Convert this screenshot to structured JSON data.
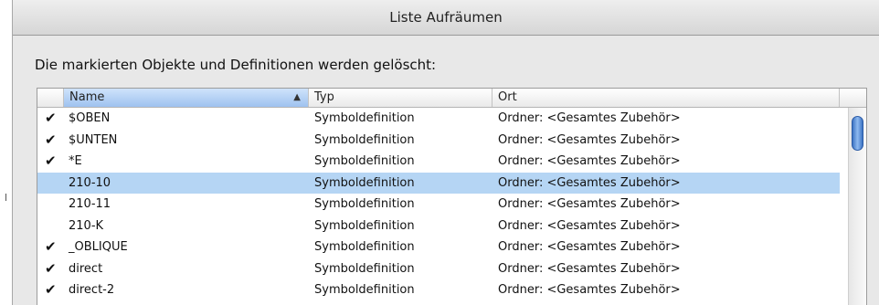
{
  "dialog": {
    "title": "Liste Aufräumen",
    "message": "Die markierten Objekte und Definitionen werden gelöscht:"
  },
  "table": {
    "columns": {
      "name": "Name",
      "typ": "Typ",
      "ort": "Ort"
    },
    "sorted_column": "Name",
    "sort_direction": "ascending",
    "rows": [
      {
        "checked": "✔",
        "name": "$OBEN",
        "typ": "Symboldefinition",
        "ort": "Ordner: <Gesamtes Zubehör>"
      },
      {
        "checked": "✔",
        "name": "$UNTEN",
        "typ": "Symboldefinition",
        "ort": "Ordner: <Gesamtes Zubehör>"
      },
      {
        "checked": "✔",
        "name": "*E",
        "typ": "Symboldefinition",
        "ort": "Ordner: <Gesamtes Zubehör>"
      },
      {
        "checked": "",
        "name": "210-10",
        "typ": "Symboldefinition",
        "ort": "Ordner: <Gesamtes Zubehör>",
        "selected": true
      },
      {
        "checked": "",
        "name": "210-11",
        "typ": "Symboldefinition",
        "ort": "Ordner: <Gesamtes Zubehör>"
      },
      {
        "checked": "",
        "name": "210-K",
        "typ": "Symboldefinition",
        "ort": "Ordner: <Gesamtes Zubehör>"
      },
      {
        "checked": "✔",
        "name": "_OBLIQUE",
        "typ": "Symboldefinition",
        "ort": "Ordner: <Gesamtes Zubehör>"
      },
      {
        "checked": "✔",
        "name": "direct",
        "typ": "Symboldefinition",
        "ort": "Ordner: <Gesamtes Zubehör>"
      },
      {
        "checked": "✔",
        "name": "direct-2",
        "typ": "Symboldefinition",
        "ort": "Ordner: <Gesamtes Zubehör>"
      }
    ]
  },
  "colors": {
    "selection": "#b5d5f4",
    "sorted_header": "#9ec2ef",
    "scroll_thumb": "#3d74c4"
  },
  "icons": {
    "check": "checkmark-icon",
    "sort": "sort-ascending-icon"
  }
}
